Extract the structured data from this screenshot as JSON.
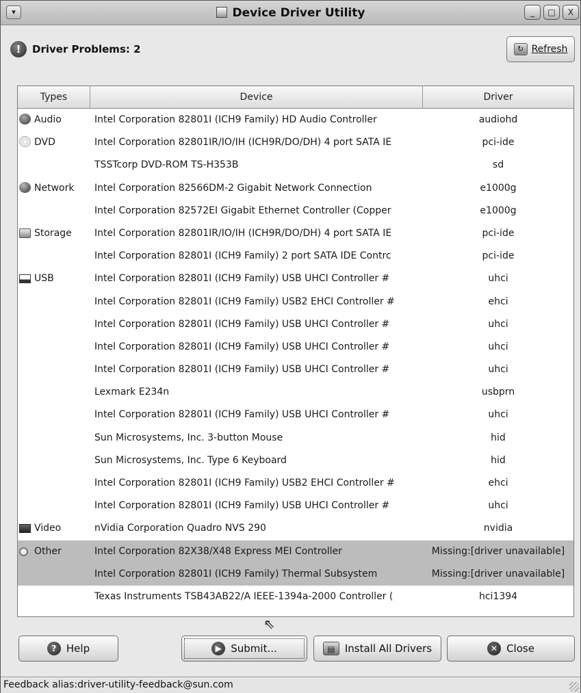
{
  "window": {
    "title": "Device Driver Utility",
    "controls": {
      "menu": "▾",
      "minimize": "_",
      "maximize": "□",
      "close": "X"
    }
  },
  "header": {
    "problems_label": "Driver Problems: 2",
    "problem_icon": "alert-icon",
    "refresh_label": "Refresh"
  },
  "table": {
    "columns": {
      "types": "Types",
      "device": "Device",
      "driver": "Driver"
    },
    "rows": [
      {
        "type": "Audio",
        "icon": "audio",
        "device": "Intel Corporation 82801I (ICH9 Family) HD Audio Controller",
        "driver": "audiohd"
      },
      {
        "type": "DVD",
        "icon": "dvd",
        "device": "Intel Corporation 82801IR/IO/IH (ICH9R/DO/DH) 4 port SATA IE",
        "driver": "pci-ide"
      },
      {
        "type": "",
        "icon": "",
        "device": "TSSTcorp DVD-ROM TS-H353B",
        "driver": "sd"
      },
      {
        "type": "Network",
        "icon": "network",
        "device": "Intel Corporation 82566DM-2 Gigabit Network Connection",
        "driver": "e1000g"
      },
      {
        "type": "",
        "icon": "",
        "device": "Intel Corporation 82572EI Gigabit Ethernet Controller (Copper",
        "driver": "e1000g"
      },
      {
        "type": "Storage",
        "icon": "storage",
        "device": "Intel Corporation 82801IR/IO/IH (ICH9R/DO/DH) 4 port SATA IE",
        "driver": "pci-ide"
      },
      {
        "type": "",
        "icon": "",
        "device": "Intel Corporation 82801I (ICH9 Family) 2 port SATA IDE Contrc",
        "driver": "pci-ide"
      },
      {
        "type": "USB",
        "icon": "usb",
        "device": "Intel Corporation 82801I (ICH9 Family) USB UHCI Controller #",
        "driver": "uhci"
      },
      {
        "type": "",
        "icon": "",
        "device": "Intel Corporation 82801I (ICH9 Family) USB2 EHCI Controller #",
        "driver": "ehci"
      },
      {
        "type": "",
        "icon": "",
        "device": "Intel Corporation 82801I (ICH9 Family) USB UHCI Controller #",
        "driver": "uhci"
      },
      {
        "type": "",
        "icon": "",
        "device": "Intel Corporation 82801I (ICH9 Family) USB UHCI Controller #",
        "driver": "uhci"
      },
      {
        "type": "",
        "icon": "",
        "device": "Intel Corporation 82801I (ICH9 Family) USB UHCI Controller #",
        "driver": "uhci"
      },
      {
        "type": "",
        "icon": "",
        "device": "Lexmark E234n",
        "driver": "usbprn"
      },
      {
        "type": "",
        "icon": "",
        "device": "Intel Corporation 82801I (ICH9 Family) USB UHCI Controller #",
        "driver": "uhci"
      },
      {
        "type": "",
        "icon": "",
        "device": "Sun Microsystems, Inc. 3-button Mouse",
        "driver": "hid"
      },
      {
        "type": "",
        "icon": "",
        "device": "Sun Microsystems, Inc. Type 6 Keyboard",
        "driver": "hid"
      },
      {
        "type": "",
        "icon": "",
        "device": "Intel Corporation 82801I (ICH9 Family) USB2 EHCI Controller #",
        "driver": "ehci"
      },
      {
        "type": "",
        "icon": "",
        "device": "Intel Corporation 82801I (ICH9 Family) USB UHCI Controller #",
        "driver": "uhci"
      },
      {
        "type": "Video",
        "icon": "video",
        "device": "nVidia Corporation Quadro NVS 290",
        "driver": "nvidia"
      },
      {
        "type": "Other",
        "icon": "other",
        "device": "Intel Corporation 82X38/X48 Express MEI Controller",
        "driver": "Missing:[driver unavailable]",
        "selected": true
      },
      {
        "type": "",
        "icon": "",
        "device": "Intel Corporation 82801I (ICH9 Family) Thermal Subsystem",
        "driver": "Missing:[driver unavailable]",
        "selected": true
      },
      {
        "type": "",
        "icon": "",
        "device": "Texas Instruments TSB43AB22/A IEEE-1394a-2000 Controller (",
        "driver": "hci1394"
      }
    ]
  },
  "buttons": {
    "help": "Help",
    "submit": "Submit...",
    "install_all": "Install All Drivers",
    "close": "Close"
  },
  "statusbar": {
    "text": "Feedback alias:driver-utility-feedback@sun.com"
  }
}
